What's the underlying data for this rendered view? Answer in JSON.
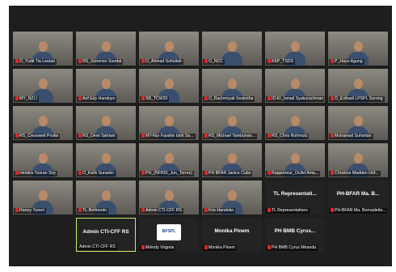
{
  "meeting": {
    "rows": [
      [
        {
          "name": "O_Yudit Tia Lestari",
          "muted": true,
          "video": true
        },
        {
          "name": "RS_Solomon Sundat",
          "muted": true,
          "video": true
        },
        {
          "name": "O_Ahmad Sofiullah",
          "muted": true,
          "video": true
        },
        {
          "name": "O_NCC",
          "muted": true,
          "video": true
        },
        {
          "name": "KKP_TSDS",
          "muted": true,
          "video": true
        },
        {
          "name": "P_Hayu Agung",
          "muted": true,
          "video": true
        }
      ],
      [
        {
          "name": "MY_NZLI",
          "muted": true,
          "video": true
        },
        {
          "name": "Arif Edy Handoyo",
          "muted": true,
          "video": true
        },
        {
          "name": "SB_TCW20",
          "muted": true,
          "video": true
        },
        {
          "name": "O_Rachmiyati Sesimiha",
          "muted": true,
          "video": true
        },
        {
          "name": "ID-KI_Ismail Syakurachman",
          "muted": true,
          "video": true
        },
        {
          "name": "O_Evihadi LPSPL Sorong",
          "muted": true,
          "video": true
        }
      ],
      [
        {
          "name": "RS_Cresswell Poske",
          "muted": true,
          "video": true
        },
        {
          "name": "RS_Dewi Satriani",
          "muted": true,
          "video": true
        },
        {
          "name": "MY-Nur Farahin binti Sa...",
          "muted": true,
          "video": true
        },
        {
          "name": "RS_Michael Tambunan...",
          "muted": true,
          "video": true
        },
        {
          "name": "RS_Chris Rohmulu",
          "muted": true,
          "video": true
        },
        {
          "name": "Muhamad Suhartan",
          "muted": true,
          "video": true
        }
      ],
      [
        {
          "name": "Hendra Yusran Siry",
          "muted": true,
          "video": true
        },
        {
          "name": "O_Kelik Sunarko",
          "muted": true,
          "video": true
        },
        {
          "name": "PH_(NFRDI_Jun_Torres)",
          "muted": true,
          "video": true
        },
        {
          "name": "PH BFAR Janice Cubo",
          "muted": true,
          "video": true
        },
        {
          "name": "Rapporteur_Ocifel Ama...",
          "muted": true,
          "video": true
        },
        {
          "name": "Christine Madden Hof...",
          "muted": true,
          "video": true
        }
      ],
      [
        {
          "name": "Ranny Yuneri",
          "muted": true,
          "video": true
        },
        {
          "name": "TL-Befriendo",
          "muted": true,
          "video": true
        },
        {
          "name": "Admin CTI-CFF RS",
          "muted": true,
          "video": true
        },
        {
          "name": "Kris Handoko",
          "muted": true,
          "video": true
        },
        {
          "name": "TL Representatives",
          "muted": true,
          "video": false,
          "big": "TL Representati..."
        },
        {
          "name": "PH-BFAR Ma. Bernadette...",
          "muted": true,
          "video": false,
          "big": "PH-BFAR Ma. B..."
        }
      ],
      [
        {
          "name": "Admin CTI-CFF RS",
          "muted": false,
          "video": false,
          "big": "Admin CTI-CFF RS",
          "active": true
        },
        {
          "name": "Melody Virginia",
          "muted": true,
          "video": false,
          "logo": "BPSPL"
        },
        {
          "name": "Monika Pinem",
          "muted": true,
          "video": false,
          "big": "Monika Pinem"
        },
        {
          "name": "PH BMB Cyrus Miranda",
          "muted": true,
          "video": false,
          "big": "PH BMB Cyrus..."
        }
      ]
    ]
  }
}
